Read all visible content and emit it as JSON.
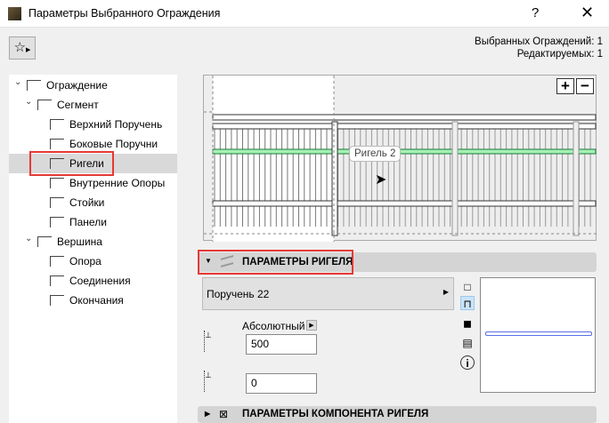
{
  "window": {
    "title": "Параметры Выбранного Ограждения",
    "help": "?",
    "close": "✕"
  },
  "header": {
    "favorites_icon": "☆",
    "selected": "Выбранных Ограждений: 1",
    "editable": "Редактируемых: 1"
  },
  "tree": [
    {
      "label": "Ограждение",
      "level": 0,
      "expanded": true
    },
    {
      "label": "Сегмент",
      "level": 1,
      "expanded": true
    },
    {
      "label": "Верхний Поручень",
      "level": 2
    },
    {
      "label": "Боковые Поручни",
      "level": 2
    },
    {
      "label": "Ригели",
      "level": 2,
      "selected": true
    },
    {
      "label": "Внутренние Опоры",
      "level": 2
    },
    {
      "label": "Стойки",
      "level": 2
    },
    {
      "label": "Панели",
      "level": 2
    },
    {
      "label": "Вершина",
      "level": 1,
      "expanded": true
    },
    {
      "label": "Опора",
      "level": 2
    },
    {
      "label": "Соединения",
      "level": 2
    },
    {
      "label": "Окончания",
      "level": 2
    }
  ],
  "preview": {
    "zoom_in": "+",
    "zoom_out": "−",
    "tooltip": "Ригель 2"
  },
  "section1": {
    "title": "ПАРАМЕТРЫ РИГЕЛЯ",
    "profile": "Поручень 22",
    "mode_label": "Абсолютный",
    "height_value": "500",
    "offset_value": "0"
  },
  "section2": {
    "title": "ПАРАМЕТРЫ КОМПОНЕНТА РИГЕЛЯ"
  },
  "colors": {
    "highlight": "#a5f0b4",
    "selection_box": "#e53935",
    "preview_line": "#5a6ee8"
  }
}
